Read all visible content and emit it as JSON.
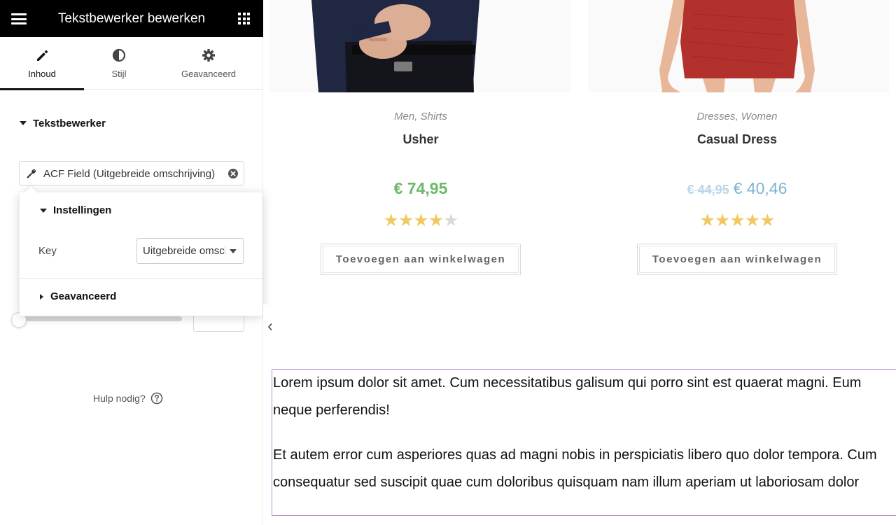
{
  "panel": {
    "title": "Tekstbewerker bewerken",
    "menu_icon": "hamburger-icon",
    "apps_icon": "grid-icon",
    "tabs": [
      {
        "label": "Inhoud",
        "icon": "pencil-icon",
        "active": true
      },
      {
        "label": "Stijl",
        "icon": "half-circle-icon",
        "active": false
      },
      {
        "label": "Geavanceerd",
        "icon": "gear-icon",
        "active": false
      }
    ],
    "section_title": "Tekstbewerker",
    "dynamic_field": {
      "label": "ACF Field (Uitgebreide omschrijving)",
      "icon": "wrench-icon",
      "clear_icon": "close-circle-icon"
    },
    "popover": {
      "settings_title": "Instellingen",
      "key_label": "Key",
      "key_value": "Uitgebreide omschrijving",
      "advanced_title": "Geavanceerd"
    },
    "help_text": "Hulp nodig?",
    "help_icon": "question-circle-icon",
    "collapse_icon": "chevron-left-icon"
  },
  "products": [
    {
      "categories": [
        "Men",
        "Shirts"
      ],
      "name": "Usher",
      "price": "€ 74,95",
      "rating": 4,
      "button": "Toevoegen aan winkelwagen"
    },
    {
      "categories": [
        "Dresses",
        "Women"
      ],
      "name": "Casual Dress",
      "price_old": "€ 44,95",
      "price_new": "€ 40,46",
      "rating": 5,
      "button": "Toevoegen aan winkelwagen"
    }
  ],
  "text_widget": {
    "paragraphs": [
      [
        "Lorem ipsum dolor sit amet. Cum necessitatibus galisum qui porro sint est quaerat magni. Eum",
        "neque perferendis!"
      ],
      [
        "Et autem error cum asperiores quas ad magni nobis in perspiciatis libero quo dolor tempora. Cum",
        "consequatur sed suscipit quae cum doloribus quisquam nam illum aperiam ut laboriosam dolor"
      ]
    ]
  },
  "colors": {
    "header_bg": "#000000",
    "price_green": "#6bb86a",
    "price_blue": "#7fb3d0",
    "star": "#f0c960",
    "text_box_border": "#b98bd3",
    "dress_red": "#b3312d",
    "shirt_navy": "#1f2742"
  }
}
